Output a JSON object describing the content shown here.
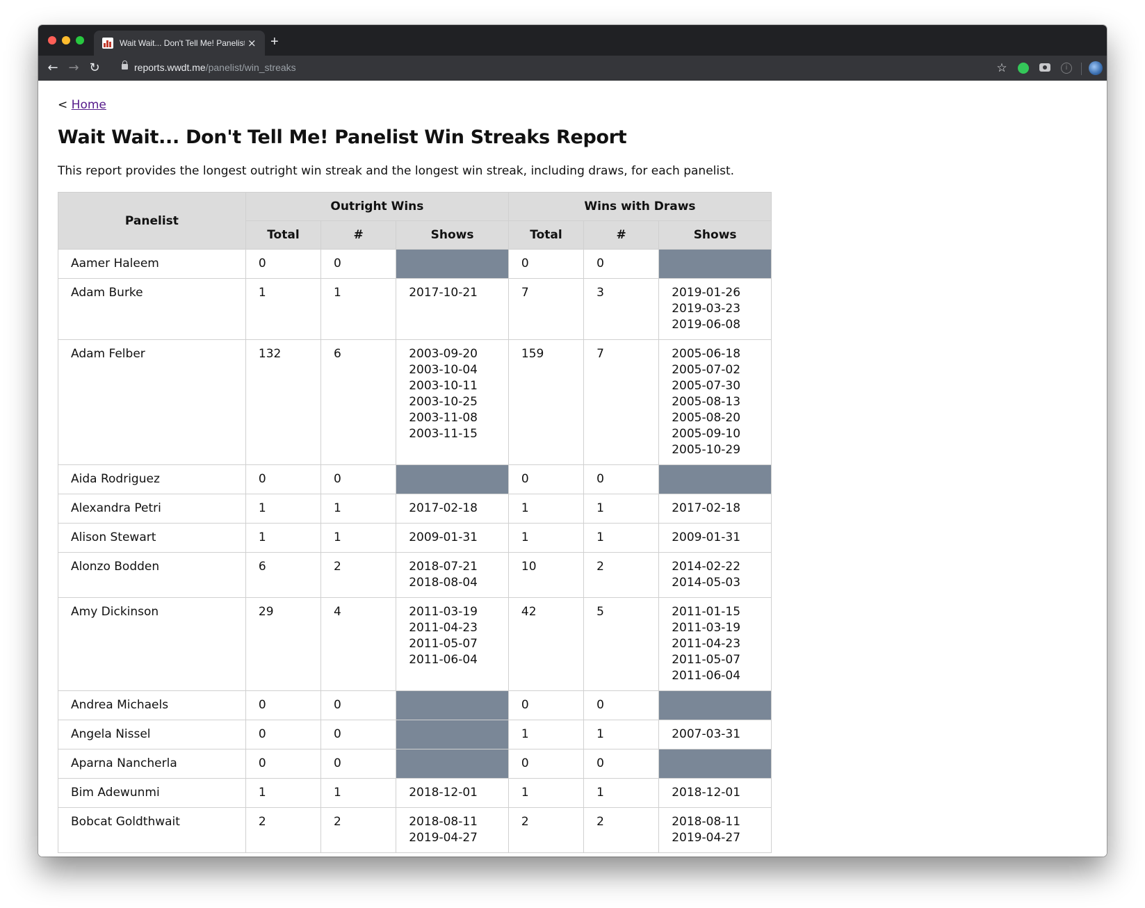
{
  "browser": {
    "tab_title": "Wait Wait... Don't Tell Me! Panelist Win Streaks Report",
    "url_host": "reports.wwdt.me",
    "url_path": "/panelist/win_streaks",
    "new_tab_symbol": "+",
    "close_symbol": "×"
  },
  "page": {
    "home_prefix": "< ",
    "home_link": "Home",
    "title": "Wait Wait... Don't Tell Me! Panelist Win Streaks Report",
    "description": "This report provides the longest outright win streak and the longest win streak, including draws, for each panelist."
  },
  "table": {
    "headers": {
      "panelist": "Panelist",
      "outright_wins": "Outright Wins",
      "wins_with_draws": "Wins with Draws",
      "total": "Total",
      "count": "#",
      "shows": "Shows"
    },
    "empty_shows_color": "#7a8797",
    "rows": [
      {
        "panelist": "Aamer Haleem",
        "outright_total": "0",
        "outright_count": "0",
        "outright_shows": [],
        "draws_total": "0",
        "draws_count": "0",
        "draws_shows": []
      },
      {
        "panelist": "Adam Burke",
        "outright_total": "1",
        "outright_count": "1",
        "outright_shows": [
          "2017-10-21"
        ],
        "draws_total": "7",
        "draws_count": "3",
        "draws_shows": [
          "2019-01-26",
          "2019-03-23",
          "2019-06-08"
        ]
      },
      {
        "panelist": "Adam Felber",
        "outright_total": "132",
        "outright_count": "6",
        "outright_shows": [
          "2003-09-20",
          "2003-10-04",
          "2003-10-11",
          "2003-10-25",
          "2003-11-08",
          "2003-11-15"
        ],
        "draws_total": "159",
        "draws_count": "7",
        "draws_shows": [
          "2005-06-18",
          "2005-07-02",
          "2005-07-30",
          "2005-08-13",
          "2005-08-20",
          "2005-09-10",
          "2005-10-29"
        ]
      },
      {
        "panelist": "Aida Rodriguez",
        "outright_total": "0",
        "outright_count": "0",
        "outright_shows": [],
        "draws_total": "0",
        "draws_count": "0",
        "draws_shows": []
      },
      {
        "panelist": "Alexandra Petri",
        "outright_total": "1",
        "outright_count": "1",
        "outright_shows": [
          "2017-02-18"
        ],
        "draws_total": "1",
        "draws_count": "1",
        "draws_shows": [
          "2017-02-18"
        ]
      },
      {
        "panelist": "Alison Stewart",
        "outright_total": "1",
        "outright_count": "1",
        "outright_shows": [
          "2009-01-31"
        ],
        "draws_total": "1",
        "draws_count": "1",
        "draws_shows": [
          "2009-01-31"
        ]
      },
      {
        "panelist": "Alonzo Bodden",
        "outright_total": "6",
        "outright_count": "2",
        "outright_shows": [
          "2018-07-21",
          "2018-08-04"
        ],
        "draws_total": "10",
        "draws_count": "2",
        "draws_shows": [
          "2014-02-22",
          "2014-05-03"
        ]
      },
      {
        "panelist": "Amy Dickinson",
        "outright_total": "29",
        "outright_count": "4",
        "outright_shows": [
          "2011-03-19",
          "2011-04-23",
          "2011-05-07",
          "2011-06-04"
        ],
        "draws_total": "42",
        "draws_count": "5",
        "draws_shows": [
          "2011-01-15",
          "2011-03-19",
          "2011-04-23",
          "2011-05-07",
          "2011-06-04"
        ]
      },
      {
        "panelist": "Andrea Michaels",
        "outright_total": "0",
        "outright_count": "0",
        "outright_shows": [],
        "draws_total": "0",
        "draws_count": "0",
        "draws_shows": []
      },
      {
        "panelist": "Angela Nissel",
        "outright_total": "0",
        "outright_count": "0",
        "outright_shows": [],
        "draws_total": "1",
        "draws_count": "1",
        "draws_shows": [
          "2007-03-31"
        ]
      },
      {
        "panelist": "Aparna Nancherla",
        "outright_total": "0",
        "outright_count": "0",
        "outright_shows": [],
        "draws_total": "0",
        "draws_count": "0",
        "draws_shows": []
      },
      {
        "panelist": "Bim Adewunmi",
        "outright_total": "1",
        "outright_count": "1",
        "outright_shows": [
          "2018-12-01"
        ],
        "draws_total": "1",
        "draws_count": "1",
        "draws_shows": [
          "2018-12-01"
        ]
      },
      {
        "panelist": "Bobcat Goldthwait",
        "outright_total": "2",
        "outright_count": "2",
        "outright_shows": [
          "2018-08-11",
          "2019-04-27"
        ],
        "draws_total": "2",
        "draws_count": "2",
        "draws_shows": [
          "2018-08-11",
          "2019-04-27"
        ]
      }
    ]
  }
}
